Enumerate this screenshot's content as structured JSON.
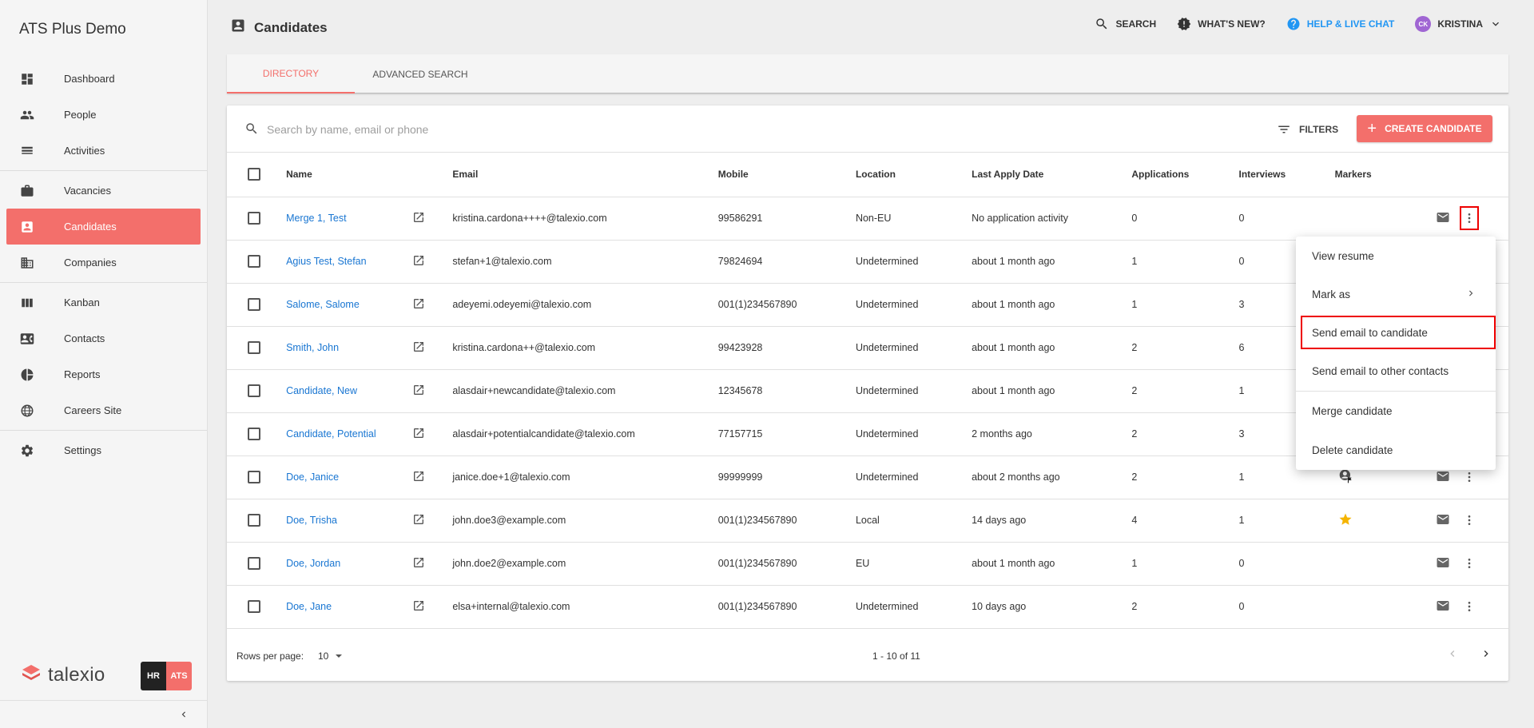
{
  "app_title": "ATS Plus Demo",
  "sidebar": {
    "items": [
      {
        "label": "Dashboard",
        "icon": "dashboard-icon"
      },
      {
        "label": "People",
        "icon": "people-icon"
      },
      {
        "label": "Activities",
        "icon": "activities-icon"
      },
      {
        "label": "Vacancies",
        "icon": "briefcase-icon"
      },
      {
        "label": "Candidates",
        "icon": "candidate-icon",
        "active": true
      },
      {
        "label": "Companies",
        "icon": "building-icon"
      },
      {
        "label": "Kanban",
        "icon": "kanban-icon"
      },
      {
        "label": "Contacts",
        "icon": "contact-card-icon"
      },
      {
        "label": "Reports",
        "icon": "pie-chart-icon"
      },
      {
        "label": "Careers Site",
        "icon": "globe-icon"
      },
      {
        "label": "Settings",
        "icon": "gear-icon"
      }
    ],
    "brand": "talexio",
    "badge_hr": "HR",
    "badge_ats": "ATS"
  },
  "header": {
    "title": "Candidates",
    "search": "SEARCH",
    "whats_new": "WHAT'S NEW?",
    "help": "HELP & LIVE CHAT",
    "user_initials": "CK",
    "user_name": "KRISTINA"
  },
  "tabs": [
    {
      "label": "DIRECTORY",
      "active": true
    },
    {
      "label": "ADVANCED SEARCH",
      "active": false
    }
  ],
  "toolbar": {
    "search_placeholder": "Search by name, email or phone",
    "filters_label": "FILTERS",
    "create_label": "CREATE CANDIDATE"
  },
  "table": {
    "columns": [
      "Name",
      "Email",
      "Mobile",
      "Location",
      "Last Apply Date",
      "Applications",
      "Interviews",
      "Markers"
    ],
    "rows": [
      {
        "name": "Merge 1, Test",
        "email": "kristina.cardona++++@talexio.com",
        "mobile": "99586291",
        "location": "Non-EU",
        "last_apply": "No application activity",
        "applications": "0",
        "interviews": "0",
        "marker": ""
      },
      {
        "name": "Agius Test, Stefan",
        "email": "stefan+1@talexio.com",
        "mobile": "79824694",
        "location": "Undetermined",
        "last_apply": "about 1 month ago",
        "applications": "1",
        "interviews": "0",
        "marker": ""
      },
      {
        "name": "Salome, Salome",
        "email": "adeyemi.odeyemi@talexio.com",
        "mobile": "001(1)234567890",
        "location": "Undetermined",
        "last_apply": "about 1 month ago",
        "applications": "1",
        "interviews": "3",
        "marker": ""
      },
      {
        "name": "Smith, John",
        "email": "kristina.cardona++@talexio.com",
        "mobile": "99423928",
        "location": "Undetermined",
        "last_apply": "about 1 month ago",
        "applications": "2",
        "interviews": "6",
        "marker": ""
      },
      {
        "name": "Candidate, New",
        "email": "alasdair+newcandidate@talexio.com",
        "mobile": "12345678",
        "location": "Undetermined",
        "last_apply": "about 1 month ago",
        "applications": "2",
        "interviews": "1",
        "marker": ""
      },
      {
        "name": "Candidate, Potential",
        "email": "alasdair+potentialcandidate@talexio.com",
        "mobile": "77157715",
        "location": "Undetermined",
        "last_apply": "2 months ago",
        "applications": "2",
        "interviews": "3",
        "marker": ""
      },
      {
        "name": "Doe, Janice",
        "email": "janice.doe+1@talexio.com",
        "mobile": "99999999",
        "location": "Undetermined",
        "last_apply": "about 2 months ago",
        "applications": "2",
        "interviews": "1",
        "marker": "person-flag-icon"
      },
      {
        "name": "Doe, Trisha",
        "email": "john.doe3@example.com",
        "mobile": "001(1)234567890",
        "location": "Local",
        "last_apply": "14 days ago",
        "applications": "4",
        "interviews": "1",
        "marker": "star-icon"
      },
      {
        "name": "Doe, Jordan",
        "email": "john.doe2@example.com",
        "mobile": "001(1)234567890",
        "location": "EU",
        "last_apply": "about 1 month ago",
        "applications": "1",
        "interviews": "0",
        "marker": ""
      },
      {
        "name": "Doe, Jane",
        "email": "elsa+internal@talexio.com",
        "mobile": "001(1)234567890",
        "location": "Undetermined",
        "last_apply": "10 days ago",
        "applications": "2",
        "interviews": "0",
        "marker": ""
      }
    ]
  },
  "pagination": {
    "rows_per_page_label": "Rows per page:",
    "rows_per_page": "10",
    "range": "1 - 10 of 11"
  },
  "context_menu": {
    "items": [
      "View resume",
      "Mark as",
      "Send email to candidate",
      "Send email to other contacts",
      "Merge candidate",
      "Delete candidate"
    ]
  },
  "colors": {
    "accent": "#f36f6b",
    "link": "#1976d2",
    "help": "#2196f3",
    "star": "#f5b400",
    "avatar": "#a066d3"
  }
}
